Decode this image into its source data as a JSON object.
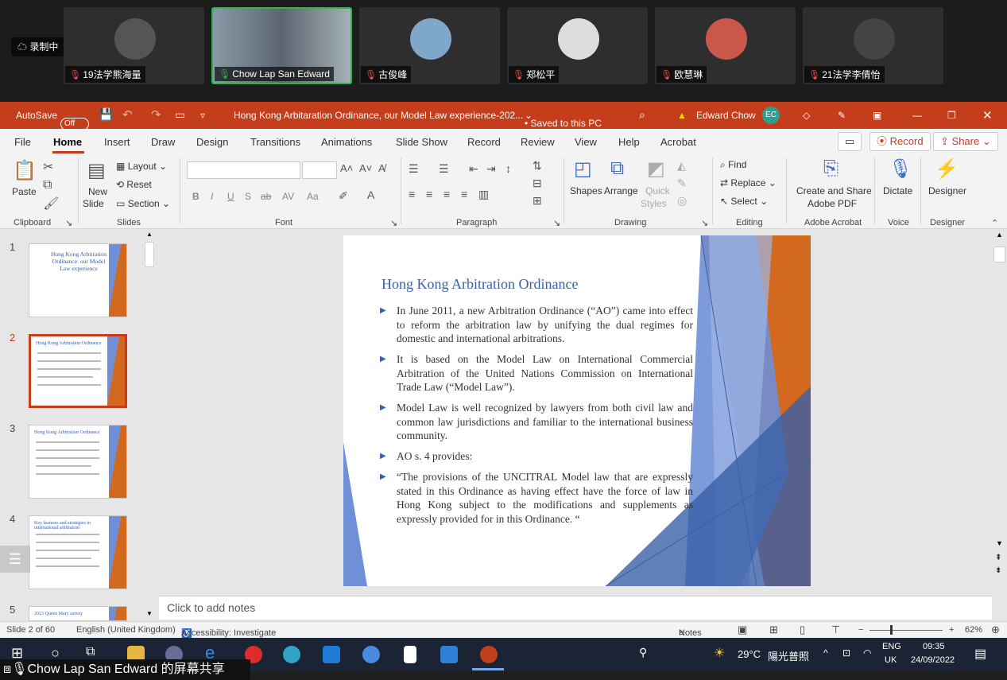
{
  "meeting": {
    "recording_label": "录制中",
    "participants": [
      {
        "name": "19法学熊海量",
        "muted": true
      },
      {
        "name": "Chow Lap San Edward",
        "muted": false,
        "active": true
      },
      {
        "name": "古俊峰",
        "muted": true
      },
      {
        "name": "郑松平",
        "muted": true
      },
      {
        "name": "欧慧琳",
        "muted": true
      },
      {
        "name": "21法学李倩怡",
        "muted": true
      }
    ],
    "share_label": "Chow Lap San Edward 的屏幕共享"
  },
  "titlebar": {
    "autosave_label": "AutoSave",
    "autosave_state": "Off",
    "document_title": "Hong Kong Arbitaration Ordinance, our Model Law experience-202...",
    "save_status": "• Saved to this PC",
    "user_name": "Edward Chow",
    "user_initials": "EC"
  },
  "menu": {
    "tabs": [
      "File",
      "Home",
      "Insert",
      "Draw",
      "Design",
      "Transitions",
      "Animations",
      "Slide Show",
      "Record",
      "Review",
      "View",
      "Help",
      "Acrobat"
    ],
    "selected": "Home",
    "record_button": "Record",
    "share_button": "Share"
  },
  "ribbon": {
    "clipboard": {
      "paste": "Paste",
      "group": "Clipboard"
    },
    "slides": {
      "new_slide_1": "New",
      "new_slide_2": "Slide",
      "layout": "Layout",
      "reset": "Reset",
      "section": "Section",
      "group": "Slides"
    },
    "font": {
      "group": "Font",
      "bold": "B",
      "italic": "I",
      "underline": "U",
      "shadow": "S",
      "strike": "ab",
      "spacing": "AV",
      "case": "Aa"
    },
    "paragraph": {
      "group": "Paragraph"
    },
    "drawing": {
      "shapes": "Shapes",
      "arrange": "Arrange",
      "quick_styles_1": "Quick",
      "quick_styles_2": "Styles",
      "group": "Drawing"
    },
    "editing": {
      "find": "Find",
      "replace": "Replace",
      "select": "Select",
      "group": "Editing"
    },
    "acrobat": {
      "label_1": "Create and Share",
      "label_2": "Adobe PDF",
      "group": "Adobe Acrobat"
    },
    "voice": {
      "dictate": "Dictate",
      "group": "Voice"
    },
    "designer": {
      "label": "Designer",
      "group": "Designer"
    }
  },
  "thumbnails": [
    {
      "num": "1",
      "title": "Hong Kong Arbitration Ordinance: our Model Law experience"
    },
    {
      "num": "2",
      "title": "Hong Kong Arbitration Ordinance"
    },
    {
      "num": "3",
      "title": "Hong Kong Arbitration Ordinance"
    },
    {
      "num": "4",
      "title": "Key features and strategies in international arbitration"
    },
    {
      "num": "5",
      "title": "2023 Queen Mary survey"
    }
  ],
  "slide": {
    "title": "Hong Kong Arbitration Ordinance",
    "bullets": [
      "In June 2011, a new Arbitration Ordinance (“AO”) came into effect to reform the arbitration law by unifying the dual regimes for domestic and international arbitrations.",
      "It is based on the Model Law on International Commercial Arbitration of the United Nations Commission on International Trade Law (“Model Law”).",
      "Model Law is well recognized by lawyers from both civil law and common law jurisdictions and familiar to the international business community.",
      "AO s. 4 provides:",
      "“The provisions of the UNCITRAL Model law that are expressly stated in this Ordinance as having effect have the force of law in Hong Kong subject to the modifications and supplements as expressly provided for in this Ordinance. “"
    ],
    "page_number": "2"
  },
  "notes_placeholder": "Click to add notes",
  "status": {
    "slide_pos": "Slide 2 of 60",
    "language": "English (United Kingdom)",
    "accessibility": "Accessibility: Investigate",
    "notes": "Notes",
    "zoom": "62%"
  },
  "taskbar": {
    "weather": "29°C",
    "weather_text": "陽光普照",
    "lang_1": "ENG",
    "lang_2": "UK",
    "time": "09:35",
    "date": "24/09/2022"
  },
  "colors": {
    "accent": "#c43e1c",
    "slide_blue": "#3a5fa8",
    "slide_orange": "#d2691e"
  }
}
